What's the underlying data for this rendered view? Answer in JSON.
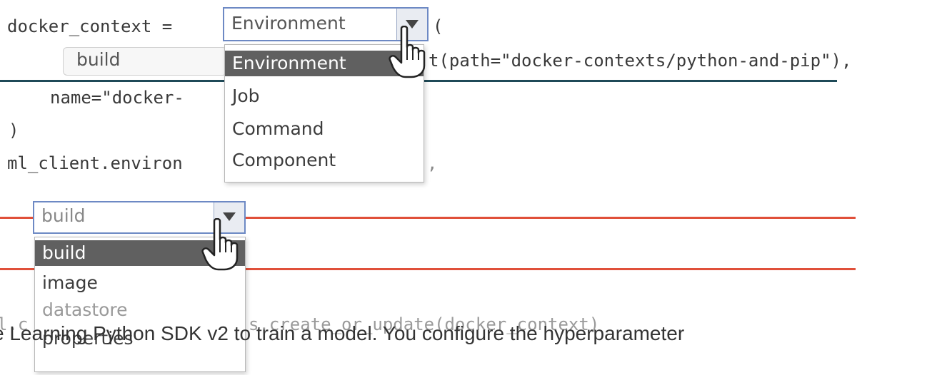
{
  "code": {
    "line1": "docker_context = ",
    "paren": "(",
    "line2_tail": "t(path=\"docker-contexts/python-and-pip\"),",
    "line3": "name=\"docker-",
    "line4": ")",
    "line5": "ml_client.environ",
    "line5_tail": ",",
    "line6_faded": "l.c",
    "line6_tail": "s.create_or_update(docker_context)"
  },
  "dropdown1": {
    "selected": "Environment",
    "options": [
      "Environment",
      "Job",
      "Command",
      "Component"
    ],
    "highlighted_index": 0
  },
  "inline_hint": {
    "text": "build"
  },
  "dropdown2": {
    "selected": "build",
    "options": [
      "build",
      "image",
      "datastore",
      "properties"
    ],
    "highlighted_index": 0
  },
  "question_text": "e Learning Python SDK v2 to train a model. You configure the hyperparameter",
  "colors": {
    "teal_line": "#1f4a58",
    "red_line": "#e0503a",
    "select_border": "#6d89c4",
    "highlight": "#606060"
  },
  "icons": [
    "chevron-down-icon",
    "hand-pointer-icon"
  ]
}
